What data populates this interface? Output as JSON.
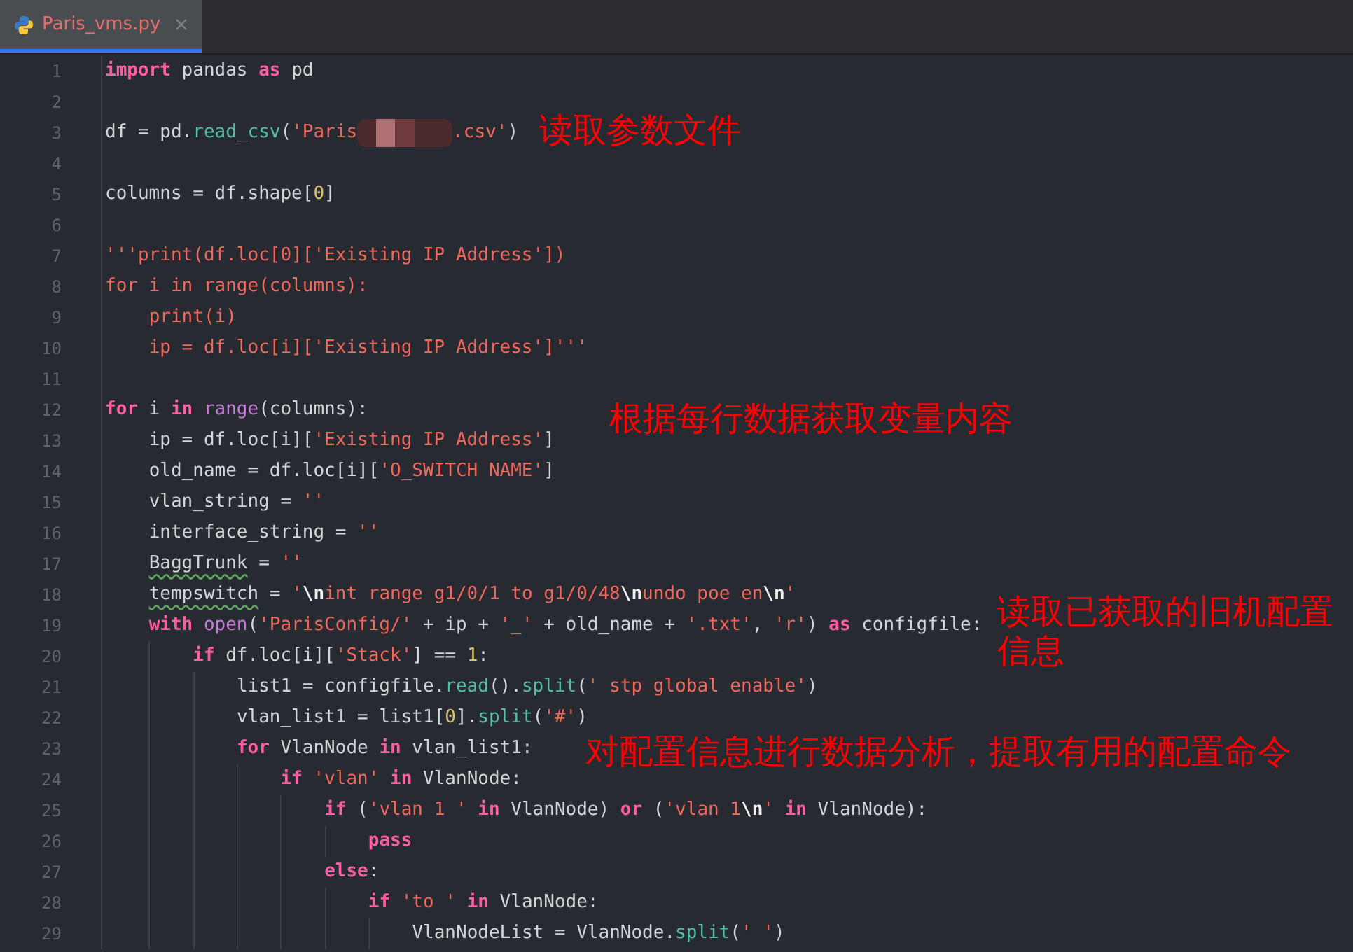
{
  "tabs": [
    {
      "label": "Paris_vms.py",
      "selected": true
    }
  ],
  "lines": [
    {
      "number": "1",
      "tokens": [
        {
          "kind": "kw",
          "text": "import"
        },
        {
          "kind": "plain",
          "text": " pandas "
        },
        {
          "kind": "kw",
          "text": "as"
        },
        {
          "kind": "plain",
          "text": " pd"
        }
      ]
    },
    {
      "number": "2"
    },
    {
      "number": "3",
      "tokens": [
        {
          "kind": "plain",
          "text": "df = pd."
        },
        {
          "kind": "fn",
          "text": "read_csv"
        },
        {
          "kind": "plain",
          "text": "("
        },
        {
          "kind": "str",
          "text": "'Paris"
        },
        {
          "kind": "redact"
        },
        {
          "kind": "str",
          "text": ".csv'"
        },
        {
          "kind": "plain",
          "text": ")"
        }
      ]
    },
    {
      "number": "4"
    },
    {
      "number": "5",
      "tokens": [
        {
          "kind": "plain",
          "text": "columns = df.shape["
        },
        {
          "kind": "num",
          "text": "0"
        },
        {
          "kind": "plain",
          "text": "]"
        }
      ]
    },
    {
      "number": "6"
    },
    {
      "number": "7",
      "tokens": [
        {
          "kind": "str",
          "text": "'''print(df.loc[0]['Existing IP Address'])"
        }
      ]
    },
    {
      "number": "8",
      "tokens": [
        {
          "kind": "str",
          "text": "for i in range(columns):"
        }
      ]
    },
    {
      "number": "9",
      "tokens": [
        {
          "kind": "str",
          "text": "    print(i)"
        }
      ]
    },
    {
      "number": "10",
      "tokens": [
        {
          "kind": "str",
          "text": "    ip = df.loc[i]['Existing IP Address']'''"
        }
      ]
    },
    {
      "number": "11"
    },
    {
      "number": "12",
      "tokens": [
        {
          "kind": "kw",
          "text": "for"
        },
        {
          "kind": "plain",
          "text": " i "
        },
        {
          "kind": "kw",
          "text": "in "
        },
        {
          "kind": "builtin",
          "text": "range"
        },
        {
          "kind": "plain",
          "text": "(columns):"
        }
      ]
    },
    {
      "number": "13",
      "tokens": [
        {
          "kind": "plain",
          "text": "    ip = df.loc[i]["
        },
        {
          "kind": "str",
          "text": "'Existing IP Address'"
        },
        {
          "kind": "plain",
          "text": "]"
        }
      ]
    },
    {
      "number": "14",
      "tokens": [
        {
          "kind": "plain",
          "text": "    old_name = df.loc[i]["
        },
        {
          "kind": "str",
          "text": "'O_SWITCH NAME'"
        },
        {
          "kind": "plain",
          "text": "]"
        }
      ]
    },
    {
      "number": "15",
      "tokens": [
        {
          "kind": "plain",
          "text": "    vlan_string = "
        },
        {
          "kind": "str",
          "text": "''"
        }
      ]
    },
    {
      "number": "16",
      "tokens": [
        {
          "kind": "plain",
          "text": "    interface_string = "
        },
        {
          "kind": "str",
          "text": "''"
        }
      ]
    },
    {
      "number": "17",
      "tokens": [
        {
          "kind": "warn",
          "text": "    BaggTrunk"
        },
        {
          "kind": "plain",
          "text": " = "
        },
        {
          "kind": "str",
          "text": "''"
        }
      ]
    },
    {
      "number": "18",
      "tokens": [
        {
          "kind": "warn",
          "text": "    tempswitch"
        },
        {
          "kind": "plain",
          "text": " = "
        },
        {
          "kind": "str",
          "text": "'"
        },
        {
          "kind": "esc",
          "text": "\\n"
        },
        {
          "kind": "str",
          "text": "int range g1/0/1 to g1/0/48"
        },
        {
          "kind": "esc",
          "text": "\\n"
        },
        {
          "kind": "str",
          "text": "undo poe en"
        },
        {
          "kind": "esc",
          "text": "\\n"
        },
        {
          "kind": "str",
          "text": "'"
        }
      ]
    },
    {
      "number": "19",
      "tokens": [
        {
          "kind": "kw",
          "text": "    with "
        },
        {
          "kind": "builtin",
          "text": "open"
        },
        {
          "kind": "plain",
          "text": "("
        },
        {
          "kind": "str",
          "text": "'ParisConfig/'"
        },
        {
          "kind": "plain",
          "text": " + ip + "
        },
        {
          "kind": "str",
          "text": "'_'"
        },
        {
          "kind": "plain",
          "text": " + old_name + "
        },
        {
          "kind": "str",
          "text": "'.txt'"
        },
        {
          "kind": "plain",
          "text": ", "
        },
        {
          "kind": "str",
          "text": "'r'"
        },
        {
          "kind": "plain",
          "text": ") "
        },
        {
          "kind": "kw",
          "text": "as"
        },
        {
          "kind": "plain",
          "text": " configfile:"
        }
      ]
    },
    {
      "number": "20",
      "tokens": [
        {
          "kind": "kw",
          "text": "        if"
        },
        {
          "kind": "plain",
          "text": " df.loc[i]["
        },
        {
          "kind": "str",
          "text": "'Stack'"
        },
        {
          "kind": "plain",
          "text": "] == "
        },
        {
          "kind": "num",
          "text": "1"
        },
        {
          "kind": "plain",
          "text": ":"
        }
      ]
    },
    {
      "number": "21",
      "tokens": [
        {
          "kind": "plain",
          "text": "            list1 = configfile."
        },
        {
          "kind": "fn",
          "text": "read"
        },
        {
          "kind": "plain",
          "text": "()."
        },
        {
          "kind": "fn",
          "text": "split"
        },
        {
          "kind": "plain",
          "text": "("
        },
        {
          "kind": "str",
          "text": "' stp global enable'"
        },
        {
          "kind": "plain",
          "text": ")"
        }
      ]
    },
    {
      "number": "22",
      "tokens": [
        {
          "kind": "plain",
          "text": "            vlan_list1 = list1["
        },
        {
          "kind": "num",
          "text": "0"
        },
        {
          "kind": "plain",
          "text": "]."
        },
        {
          "kind": "fn",
          "text": "split"
        },
        {
          "kind": "plain",
          "text": "("
        },
        {
          "kind": "str",
          "text": "'#'"
        },
        {
          "kind": "plain",
          "text": ")"
        }
      ]
    },
    {
      "number": "23",
      "tokens": [
        {
          "kind": "kw",
          "text": "            for"
        },
        {
          "kind": "plain",
          "text": " VlanNode "
        },
        {
          "kind": "kw",
          "text": "in"
        },
        {
          "kind": "plain",
          "text": " vlan_list1:"
        }
      ]
    },
    {
      "number": "24",
      "tokens": [
        {
          "kind": "kw",
          "text": "                if "
        },
        {
          "kind": "str",
          "text": "'vlan'"
        },
        {
          "kind": "kw",
          "text": " in"
        },
        {
          "kind": "plain",
          "text": " VlanNode:"
        }
      ]
    },
    {
      "number": "25",
      "tokens": [
        {
          "kind": "kw",
          "text": "                    if"
        },
        {
          "kind": "plain",
          "text": " ("
        },
        {
          "kind": "str",
          "text": "'vlan 1 '"
        },
        {
          "kind": "kw",
          "text": " in"
        },
        {
          "kind": "plain",
          "text": " VlanNode) "
        },
        {
          "kind": "kw",
          "text": "or"
        },
        {
          "kind": "plain",
          "text": " ("
        },
        {
          "kind": "str",
          "text": "'vlan 1"
        },
        {
          "kind": "esc",
          "text": "\\n"
        },
        {
          "kind": "str",
          "text": "'"
        },
        {
          "kind": "kw",
          "text": " in"
        },
        {
          "kind": "plain",
          "text": " VlanNode):"
        }
      ]
    },
    {
      "number": "26",
      "tokens": [
        {
          "kind": "kw",
          "text": "                        pass"
        }
      ]
    },
    {
      "number": "27",
      "tokens": [
        {
          "kind": "kw",
          "text": "                    else"
        },
        {
          "kind": "plain",
          "text": ":"
        }
      ]
    },
    {
      "number": "28",
      "tokens": [
        {
          "kind": "kw",
          "text": "                        if "
        },
        {
          "kind": "str",
          "text": "'to '"
        },
        {
          "kind": "kw",
          "text": " in"
        },
        {
          "kind": "plain",
          "text": " VlanNode:"
        }
      ]
    },
    {
      "number": "29",
      "tokens": [
        {
          "kind": "plain",
          "text": "                            VlanNodeList = VlanNode."
        },
        {
          "kind": "fn",
          "text": "split"
        },
        {
          "kind": "plain",
          "text": "("
        },
        {
          "kind": "str",
          "text": "' '"
        },
        {
          "kind": "plain",
          "text": ")"
        }
      ]
    }
  ],
  "annotations": [
    {
      "text": "读取参数文件"
    },
    {
      "text": "根据每行数据获取变量内容"
    },
    {
      "text": "读取已获取的旧机配置信息"
    },
    {
      "text": "对配置信息进行数据分析，提取有用的配置命令"
    }
  ]
}
